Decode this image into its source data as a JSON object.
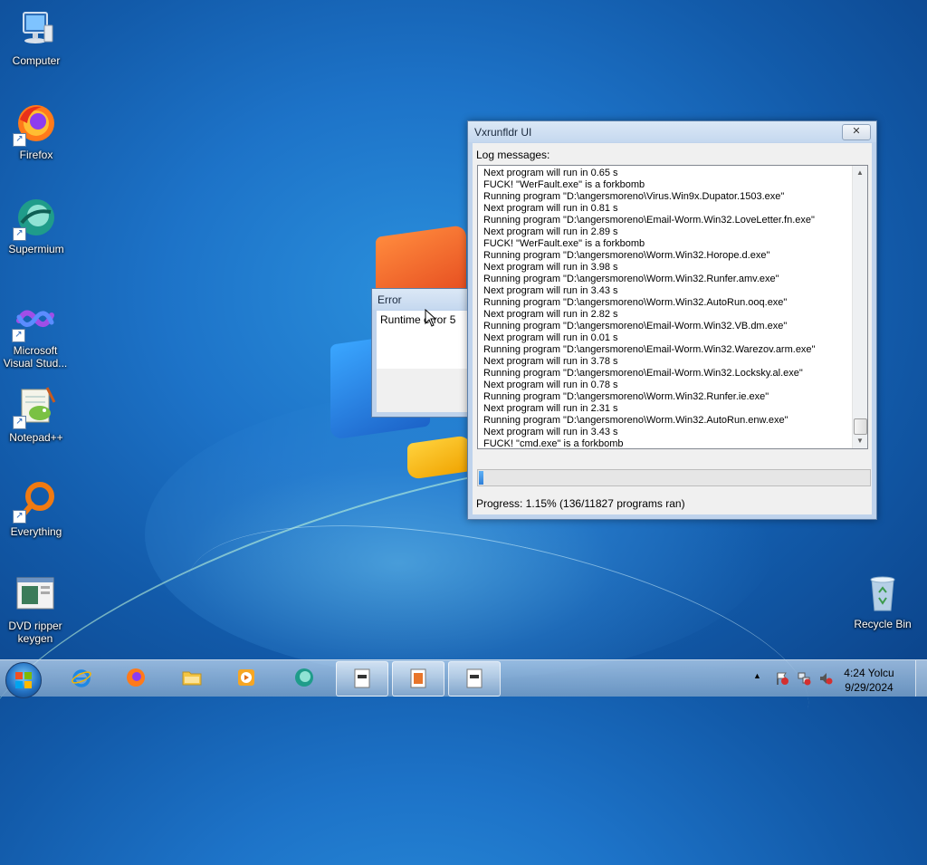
{
  "desktop": {
    "icons": [
      {
        "label": "Computer"
      },
      {
        "label": "Firefox"
      },
      {
        "label": "Supermium"
      },
      {
        "label": "Microsoft Visual Stud..."
      },
      {
        "label": "Notepad++"
      },
      {
        "label": "Everything"
      },
      {
        "label": "DVD ripper keygen"
      },
      {
        "label": "Recycle Bin"
      }
    ]
  },
  "main_window": {
    "title": "Vxrunfldr UI",
    "close_glyph": "✕",
    "log_label": "Log messages:",
    "log_lines": [
      "Next program will run in 0.65 s",
      "FUCK! \"WerFault.exe\" is a forkbomb",
      "Running program \"D:\\angersmoreno\\Virus.Win9x.Dupator.1503.exe\"",
      "Next program will run in 0.81 s",
      "Running program \"D:\\angersmoreno\\Email-Worm.Win32.LoveLetter.fn.exe\"",
      "Next program will run in 2.89 s",
      "FUCK! \"WerFault.exe\" is a forkbomb",
      "Running program \"D:\\angersmoreno\\Worm.Win32.Horope.d.exe\"",
      "Next program will run in 3.98 s",
      "Running program \"D:\\angersmoreno\\Worm.Win32.Runfer.amv.exe\"",
      "Next program will run in 3.43 s",
      "Running program \"D:\\angersmoreno\\Worm.Win32.AutoRun.ooq.exe\"",
      "Next program will run in 2.82 s",
      "Running program \"D:\\angersmoreno\\Email-Worm.Win32.VB.dm.exe\"",
      "Next program will run in 0.01 s",
      "Running program \"D:\\angersmoreno\\Email-Worm.Win32.Warezov.arm.exe\"",
      "Next program will run in 3.78 s",
      "Running program \"D:\\angersmoreno\\Email-Worm.Win32.Locksky.al.exe\"",
      "Next program will run in 0.78 s",
      "Running program \"D:\\angersmoreno\\Worm.Win32.Runfer.ie.exe\"",
      "Next program will run in 2.31 s",
      "Running program \"D:\\angersmoreno\\Worm.Win32.AutoRun.enw.exe\"",
      "Next program will run in 3.43 s",
      "FUCK! \"cmd.exe\" is a forkbomb"
    ],
    "progress_fraction": 0.0115,
    "progress_text": "Progress: 1.15% (136/11827 programs ran)"
  },
  "error_dialog": {
    "title": "Error",
    "message": "Runtime error  5"
  },
  "taskbar": {
    "pinned": [
      "internet-explorer",
      "firefox",
      "file-explorer",
      "media-player",
      "supermium"
    ],
    "open_windows": [
      "vxrunfldr-window",
      "error-window",
      "app-window"
    ],
    "clock_time": "4:24 Yolcu",
    "clock_date": "9/29/2024"
  },
  "colors": {
    "accent": "#2f7fd8",
    "window_frame": "#bfd3ec"
  }
}
